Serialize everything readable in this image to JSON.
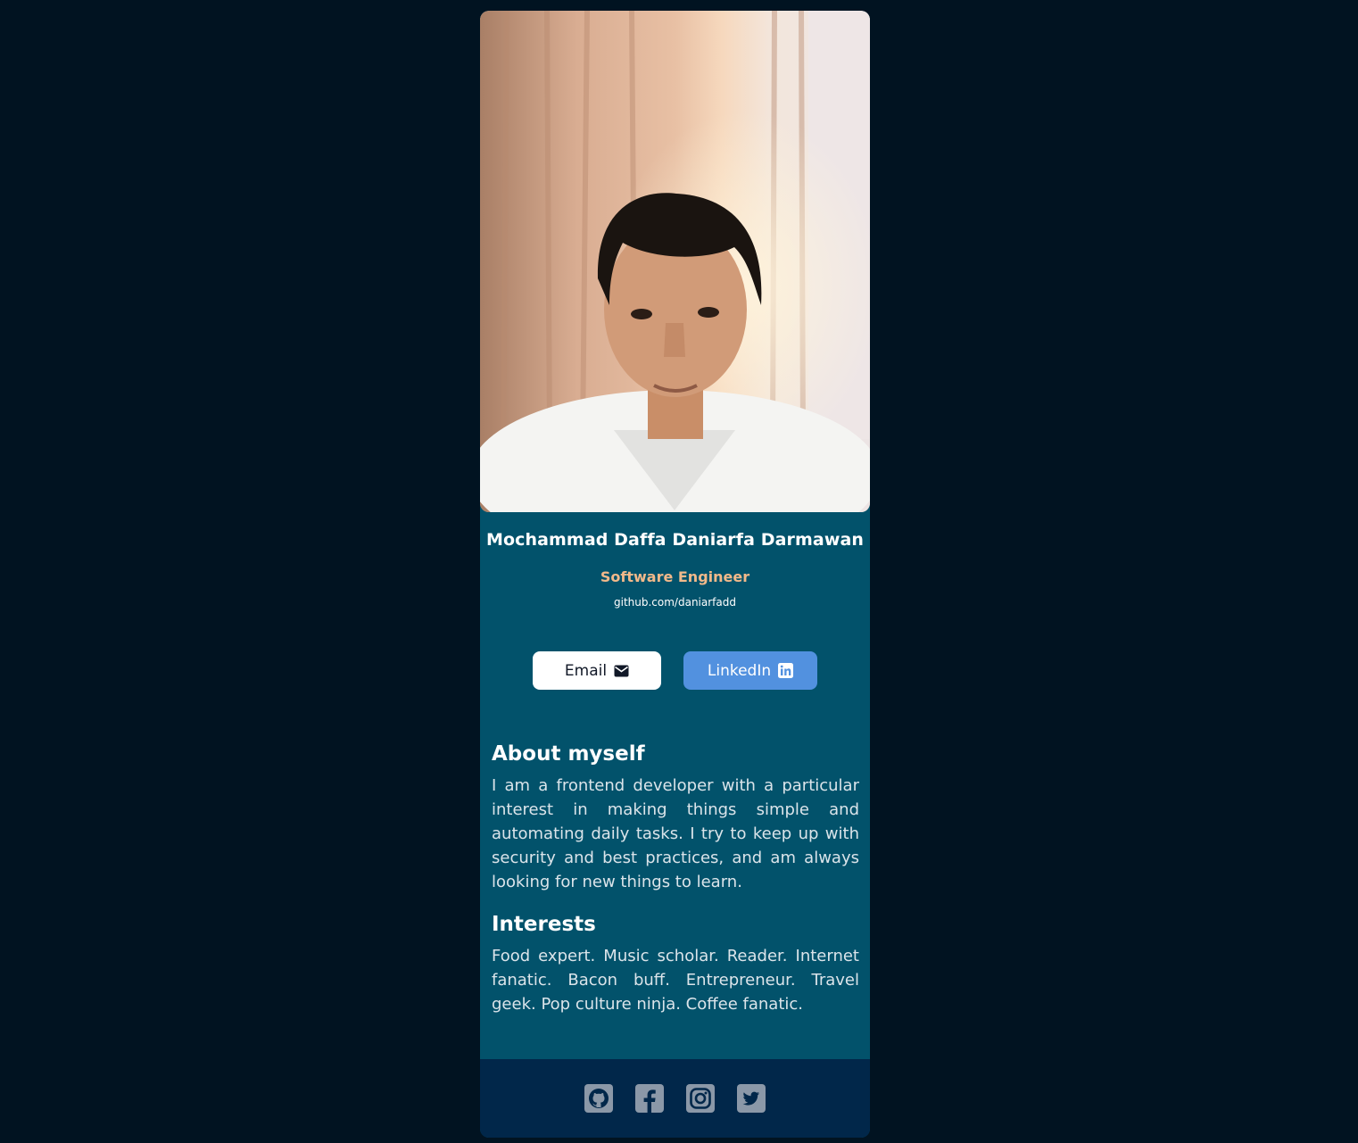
{
  "profile": {
    "name": "Mochammad Daffa Daniarfa Darmawan",
    "role": "Software Engineer",
    "website": "github.com/daniarfadd"
  },
  "buttons": {
    "email_label": "Email",
    "linkedin_label": "LinkedIn"
  },
  "about": {
    "title": "About myself",
    "text": "I am a frontend developer with a particular interest in making things simple and automating daily tasks. I try to keep up with security and best practices, and am always looking for new things to learn."
  },
  "interests": {
    "title": "Interests",
    "text": "Food expert. Music scholar. Reader. Internet fanatic. Bacon buff. Entrepreneur. Travel geek. Pop culture ninja. Coffee fanatic."
  },
  "footer": {
    "icons": [
      "github-icon",
      "facebook-icon",
      "instagram-icon",
      "twitter-icon"
    ]
  },
  "colors": {
    "page_background": "#011321",
    "card_background": "#02526b",
    "footer_background": "#01274a",
    "role_color": "#f2b98a",
    "linkedin_button": "#5291df",
    "social_icon": "#8b98a8"
  }
}
